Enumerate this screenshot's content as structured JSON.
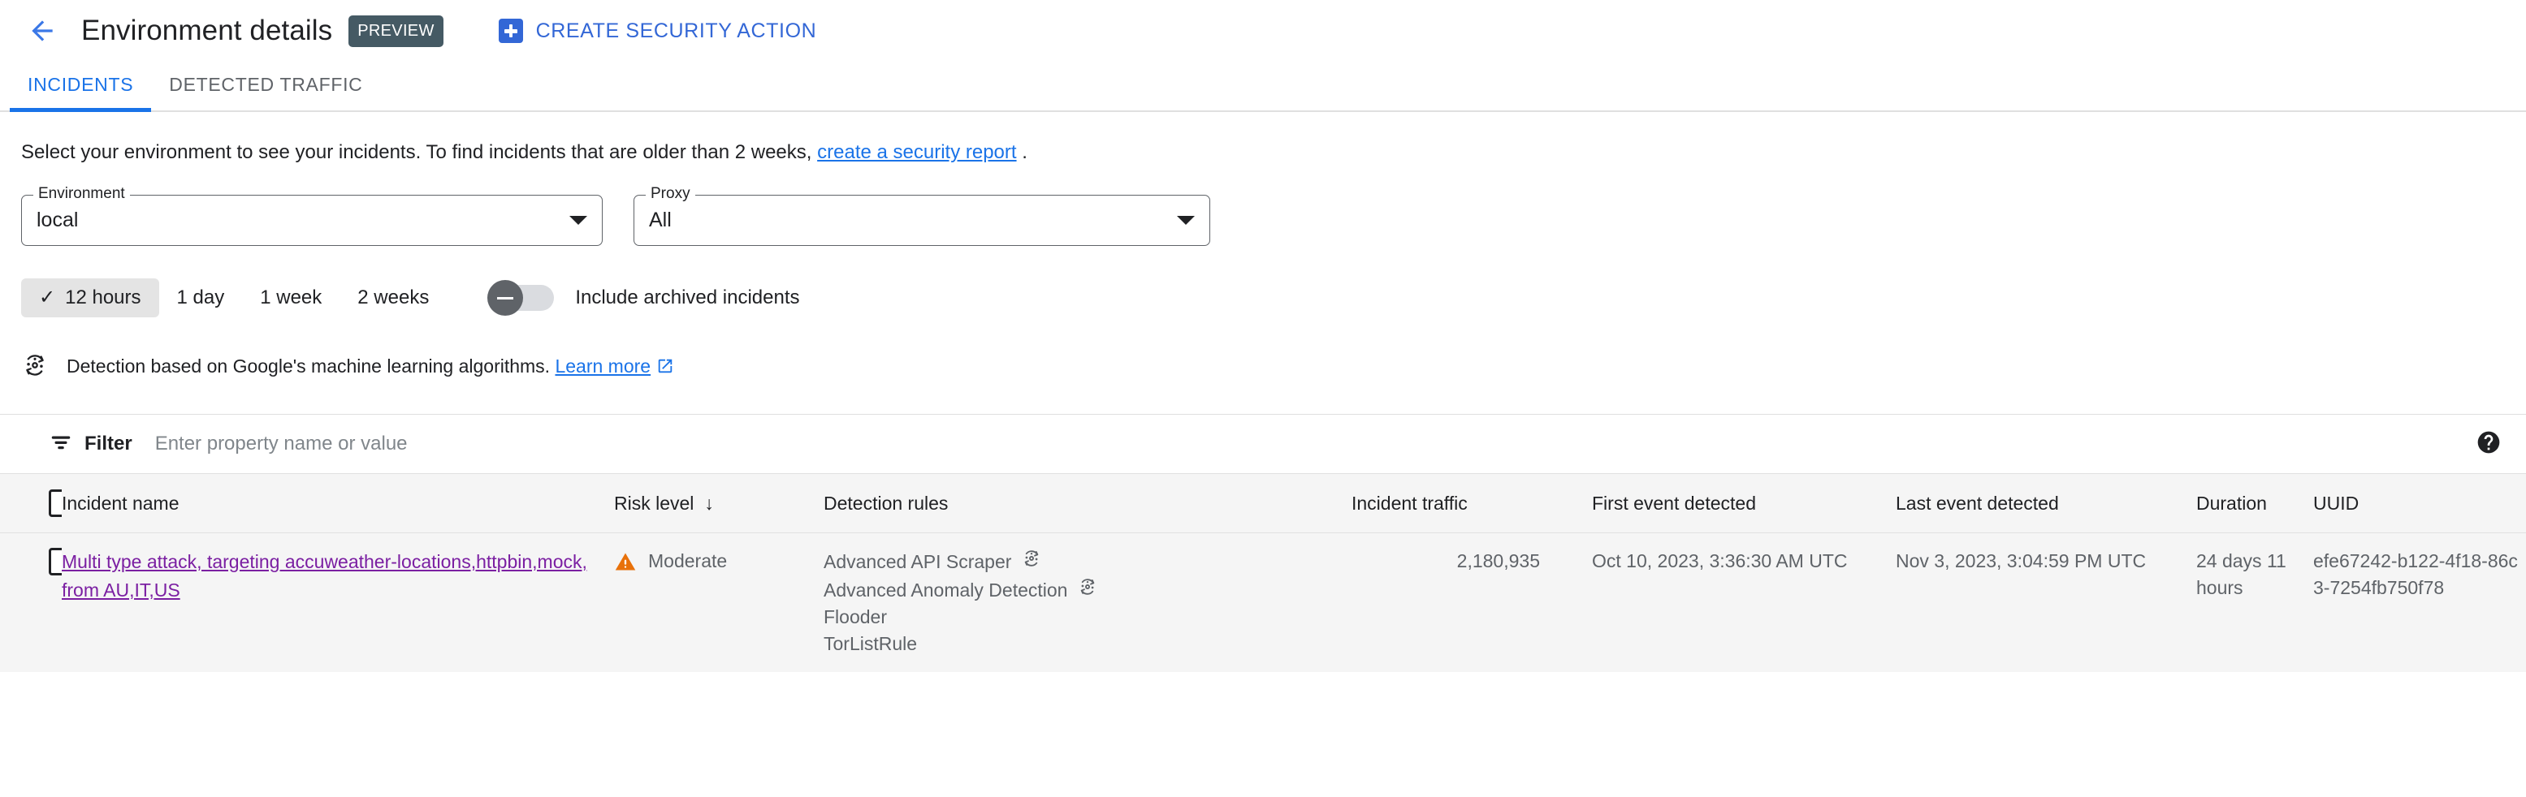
{
  "header": {
    "back_icon": "arrow-back-icon",
    "title": "Environment details",
    "preview_badge": "PREVIEW",
    "create_action_label": "CREATE SECURITY ACTION",
    "create_action_icon": "add-box-icon"
  },
  "tabs": [
    {
      "label": "INCIDENTS",
      "active": true
    },
    {
      "label": "DETECTED TRAFFIC",
      "active": false
    }
  ],
  "description": {
    "before_link": "Select your environment to see your incidents. To find incidents that are older than 2 weeks,",
    "link": "create a security report",
    "after_link": "."
  },
  "filters": {
    "environment": {
      "label": "Environment",
      "value": "local"
    },
    "proxy": {
      "label": "Proxy",
      "value": "All"
    },
    "ranges": [
      {
        "label": "12 hours",
        "selected": true
      },
      {
        "label": "1 day",
        "selected": false
      },
      {
        "label": "1 week",
        "selected": false
      },
      {
        "label": "2 weeks",
        "selected": false
      }
    ],
    "archived_toggle": {
      "label": "Include archived incidents",
      "on": false
    }
  },
  "ml_note": {
    "icon": "ml-detection-icon",
    "text": "Detection based on Google's machine learning algorithms.",
    "link": "Learn more",
    "external_icon": "open-in-new-icon"
  },
  "filter_bar": {
    "icon": "filter-icon",
    "label": "Filter",
    "placeholder": "Enter property name or value",
    "help_icon": "help-icon"
  },
  "table": {
    "columns": [
      {
        "key": "check",
        "label": ""
      },
      {
        "key": "name",
        "label": "Incident name"
      },
      {
        "key": "risk",
        "label": "Risk level",
        "sort": "desc"
      },
      {
        "key": "rules",
        "label": "Detection rules"
      },
      {
        "key": "traffic",
        "label": "Incident traffic"
      },
      {
        "key": "first",
        "label": "First event detected"
      },
      {
        "key": "last",
        "label": "Last event detected"
      },
      {
        "key": "duration",
        "label": "Duration",
        "dim": true
      },
      {
        "key": "uuid",
        "label": "UUID"
      }
    ],
    "rows": [
      {
        "name": "Multi type attack, targeting accuweather-locations,httpbin,mock, from AU,IT,US",
        "risk": "Moderate",
        "risk_icon": "warning-triangle-icon",
        "rules": [
          {
            "name": "Advanced API Scraper",
            "ml": true
          },
          {
            "name": "Advanced Anomaly Detection",
            "ml": true
          },
          {
            "name": "Flooder",
            "ml": false
          },
          {
            "name": "TorListRule",
            "ml": false
          }
        ],
        "traffic": "2,180,935",
        "first_event": "Oct 10, 2023, 3:36:30 AM UTC",
        "last_event": "Nov 3, 2023, 3:04:59 PM UTC",
        "duration": "24 days 11 hours",
        "uuid": "efe67242-b122-4f18-86c3-7254fb750f78"
      }
    ]
  },
  "colors": {
    "accent_blue": "#1a73e8",
    "create_blue": "#3367d6",
    "visited_link_purple": "#7b1fa2",
    "warning_orange": "#e8710a",
    "preview_chip": "#455a64"
  }
}
